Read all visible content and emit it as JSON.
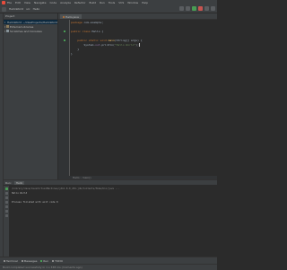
{
  "menu": {
    "items": [
      "File",
      "Edit",
      "View",
      "Navigate",
      "Code",
      "Analyze",
      "Refactor",
      "Build",
      "Run",
      "Tools",
      "VCS",
      "Window",
      "Help"
    ]
  },
  "navbar": {
    "crumbs": [
      "HelloWorld",
      "src",
      "Hello"
    ]
  },
  "project": {
    "title": "Project",
    "tree": [
      {
        "label": "HelloWorld  ~/IdeaProjects/HelloWorld",
        "depth": 0,
        "icon": "folder-icon",
        "selected": true
      },
      {
        "label": "External Libraries",
        "depth": 0,
        "icon": "library-icon",
        "selected": false
      },
      {
        "label": "Scratches and Consoles",
        "depth": 0,
        "icon": "folder-icon",
        "selected": false
      }
    ]
  },
  "editor": {
    "tab_label": "Hello.java",
    "lines": [
      {
        "n": 1,
        "parts": [
          [
            "kw",
            "package "
          ],
          [
            "pl",
            "com.example;"
          ]
        ]
      },
      {
        "n": 2,
        "parts": []
      },
      {
        "n": 3,
        "parts": [
          [
            "kw",
            "public class "
          ],
          [
            "pl",
            "Hello {"
          ]
        ]
      },
      {
        "n": 4,
        "parts": []
      },
      {
        "n": 5,
        "parts": [
          [
            "pl",
            "    "
          ],
          [
            "kw",
            "public static void "
          ],
          [
            "fn",
            "main"
          ],
          [
            "pl",
            "(String[] args) {"
          ]
        ]
      },
      {
        "n": 6,
        "parts": [
          [
            "pl",
            "        System."
          ],
          [
            "mth",
            "out"
          ],
          [
            "pl",
            ".println("
          ],
          [
            "str",
            "\"Hello World\""
          ],
          [
            "pl",
            ");"
          ]
        ]
      },
      {
        "n": 7,
        "parts": [
          [
            "pl",
            "    }"
          ]
        ]
      },
      {
        "n": 8,
        "parts": [
          [
            "pl",
            "}"
          ]
        ]
      }
    ],
    "breadcrumb": "Hello  ›  main()"
  },
  "run": {
    "label": "Run:",
    "tab": "Hello",
    "console": [
      {
        "cls": "cmd",
        "text": "/Library/Java/JavaVirtualMachines/jdk1.8.0_201.jdk/Contents/Home/bin/java ..."
      },
      {
        "cls": "out",
        "text": "Hello World"
      },
      {
        "cls": "out",
        "text": ""
      },
      {
        "cls": "out",
        "text": "Process finished with exit code 0"
      }
    ]
  },
  "toolwindows": [
    "Terminal",
    "Messages",
    "Run",
    "TODO"
  ],
  "status": {
    "message": "Build completed successfully in 1 s 338 ms (moments ago)"
  }
}
